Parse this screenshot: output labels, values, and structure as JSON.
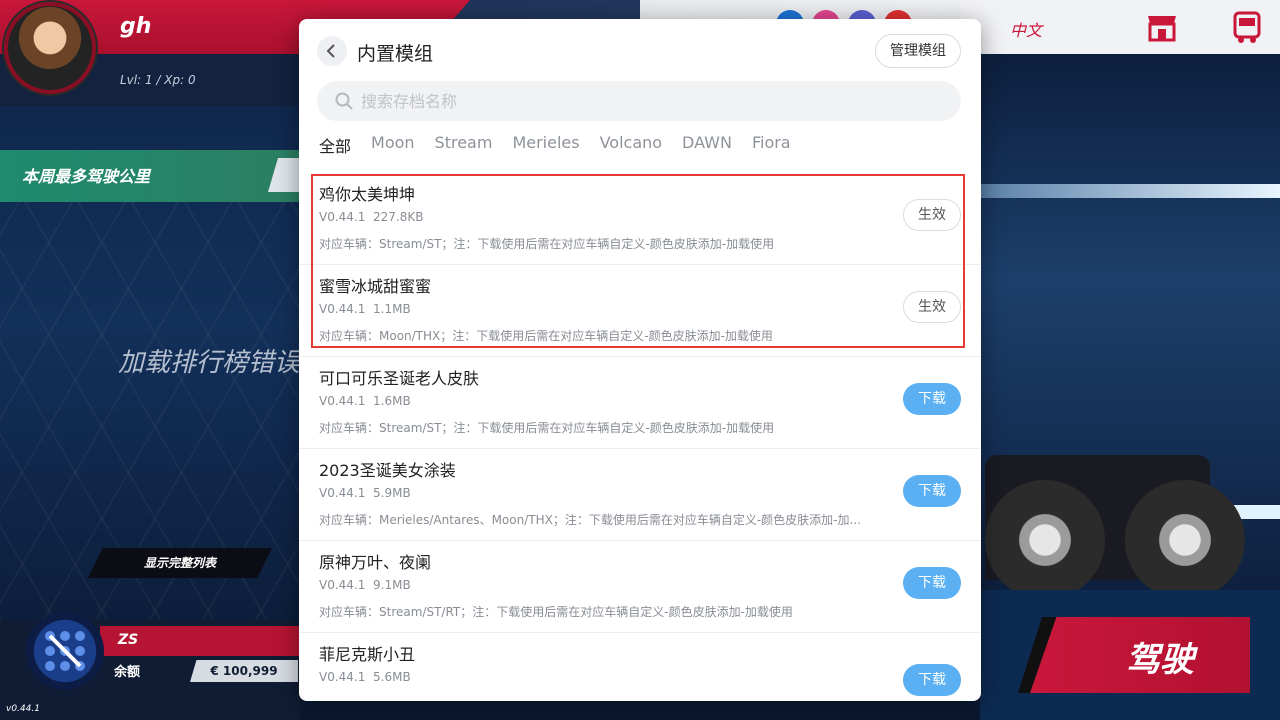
{
  "player": {
    "name": "gh",
    "level_xp": "Lvl: 1 / Xp: 0"
  },
  "weekly": {
    "label": "本周最多驾驶公里"
  },
  "leaderboard": {
    "error": "加载排行榜错误"
  },
  "show_full_list": "显示完整列表",
  "company": {
    "name": "ZS",
    "balance_label": "余额",
    "balance": "€ 100,999"
  },
  "version": "v0.44.1",
  "top_right": {
    "language": "中文"
  },
  "drive_button": "驾驶",
  "modal": {
    "title": "内置模组",
    "manage_button": "管理模组",
    "search_placeholder": "搜索存档名称",
    "tabs": [
      "全部",
      "Moon",
      "Stream",
      "Merieles",
      "Volcano",
      "DAWN",
      "Fiora"
    ],
    "items": [
      {
        "name": "鸡你太美坤坤",
        "version": "V0.44.1",
        "size": "227.8KB",
        "note": "对应车辆：Stream/ST；注：下载使用后需在对应车辆自定义-颜色皮肤添加-加载使用",
        "action": "生效"
      },
      {
        "name": "蜜雪冰城甜蜜蜜",
        "version": "V0.44.1",
        "size": "1.1MB",
        "note": "对应车辆：Moon/THX；注：下载使用后需在对应车辆自定义-颜色皮肤添加-加载使用",
        "action": "生效"
      },
      {
        "name": "可口可乐圣诞老人皮肤",
        "version": "V0.44.1",
        "size": "1.6MB",
        "note": "对应车辆：Stream/ST；注：下载使用后需在对应车辆自定义-颜色皮肤添加-加载使用",
        "action": "下载"
      },
      {
        "name": "2023圣诞美女涂装",
        "version": "V0.44.1",
        "size": "5.9MB",
        "note": "对应车辆：Merieles/Antares、Moon/THX；注：下载使用后需在对应车辆自定义-颜色皮肤添加-加...",
        "action": "下载"
      },
      {
        "name": "原神万叶、夜阑",
        "version": "V0.44.1",
        "size": "9.1MB",
        "note": "对应车辆：Stream/ST/RT；注：下载使用后需在对应车辆自定义-颜色皮肤添加-加载使用",
        "action": "下载"
      },
      {
        "name": "菲尼克斯小丑",
        "version": "V0.44.1",
        "size": "5.6MB",
        "note": "",
        "action": "下载"
      }
    ]
  },
  "colors": {
    "accent_red": "#c9173a",
    "download_blue": "#5ab0f2",
    "highlight": "#e53935"
  }
}
